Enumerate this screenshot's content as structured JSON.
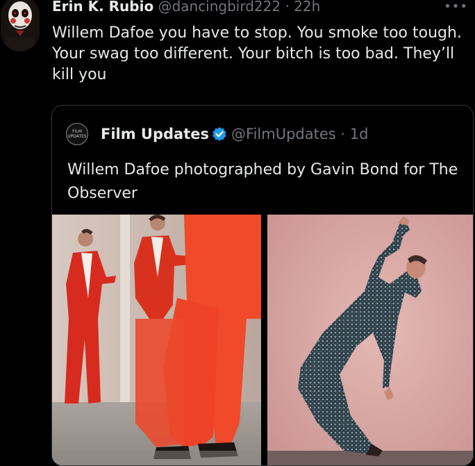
{
  "tweet": {
    "author_name": "Erin K. Rubio",
    "author_handle": "@dancingbird222",
    "separator": "·",
    "time": "22h",
    "more_icon": "more-dots-icon",
    "text": "Willem Dafoe you have to stop. You smoke too tough. Your swag too different. Your bitch is too bad. They’ll kill you"
  },
  "quote": {
    "author_name": "Film Updates",
    "author_handle": "@FilmUpdates",
    "separator": "·",
    "time": "1d",
    "verified_icon": "verified-badge-icon",
    "avatar_text_line1": "FILM",
    "avatar_text_line2": "UPDATES",
    "text": "Willem Dafoe photographed by Gavin Bond for The Observer",
    "media": [
      {
        "name": "photo-red-suit",
        "accent": "#e8452c"
      },
      {
        "name": "photo-sequin-suit",
        "accent": "#2c4a57"
      }
    ]
  }
}
